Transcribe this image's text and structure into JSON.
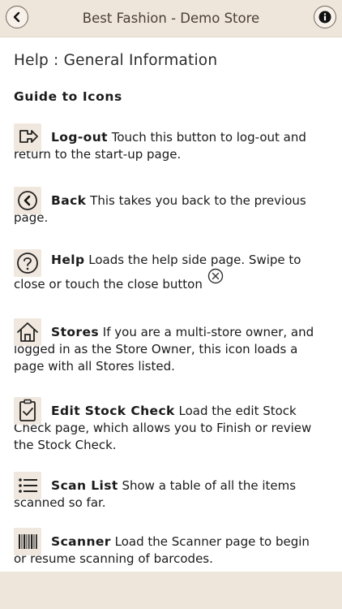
{
  "header": {
    "title": "Best Fashion - Demo Store",
    "back_icon": "chevron-left-icon",
    "info_icon": "info-icon"
  },
  "help": {
    "heading": "Help : General Information",
    "subheading": "Guide to Icons",
    "items": [
      {
        "icon": "logout-icon",
        "name": "Log-out",
        "text": "Touch this button to log-out and return to the start-up page."
      },
      {
        "icon": "back-icon",
        "name": "Back",
        "text": "This takes you back to the previous page."
      },
      {
        "icon": "help-icon",
        "name": "Help",
        "text": "Loads the help side page. Swipe to close or touch the  close button"
      },
      {
        "icon": "home-icon",
        "name": "Stores",
        "text": "If you are a multi-store owner, and logged in as the Store Owner, this icon loads a page with all Stores listed."
      },
      {
        "icon": "clipboard-check-icon",
        "name": "Edit Stock Check",
        "text": "Load the edit Stock Check page, which allows you to Finish or review the Stock Check."
      },
      {
        "icon": "list-icon",
        "name": "Scan List",
        "text": "Show a table of all the items scanned so far."
      },
      {
        "icon": "barcode-icon",
        "name": "Scanner",
        "text": "Load the Scanner page to begin or resume scanning of barcodes."
      }
    ]
  }
}
